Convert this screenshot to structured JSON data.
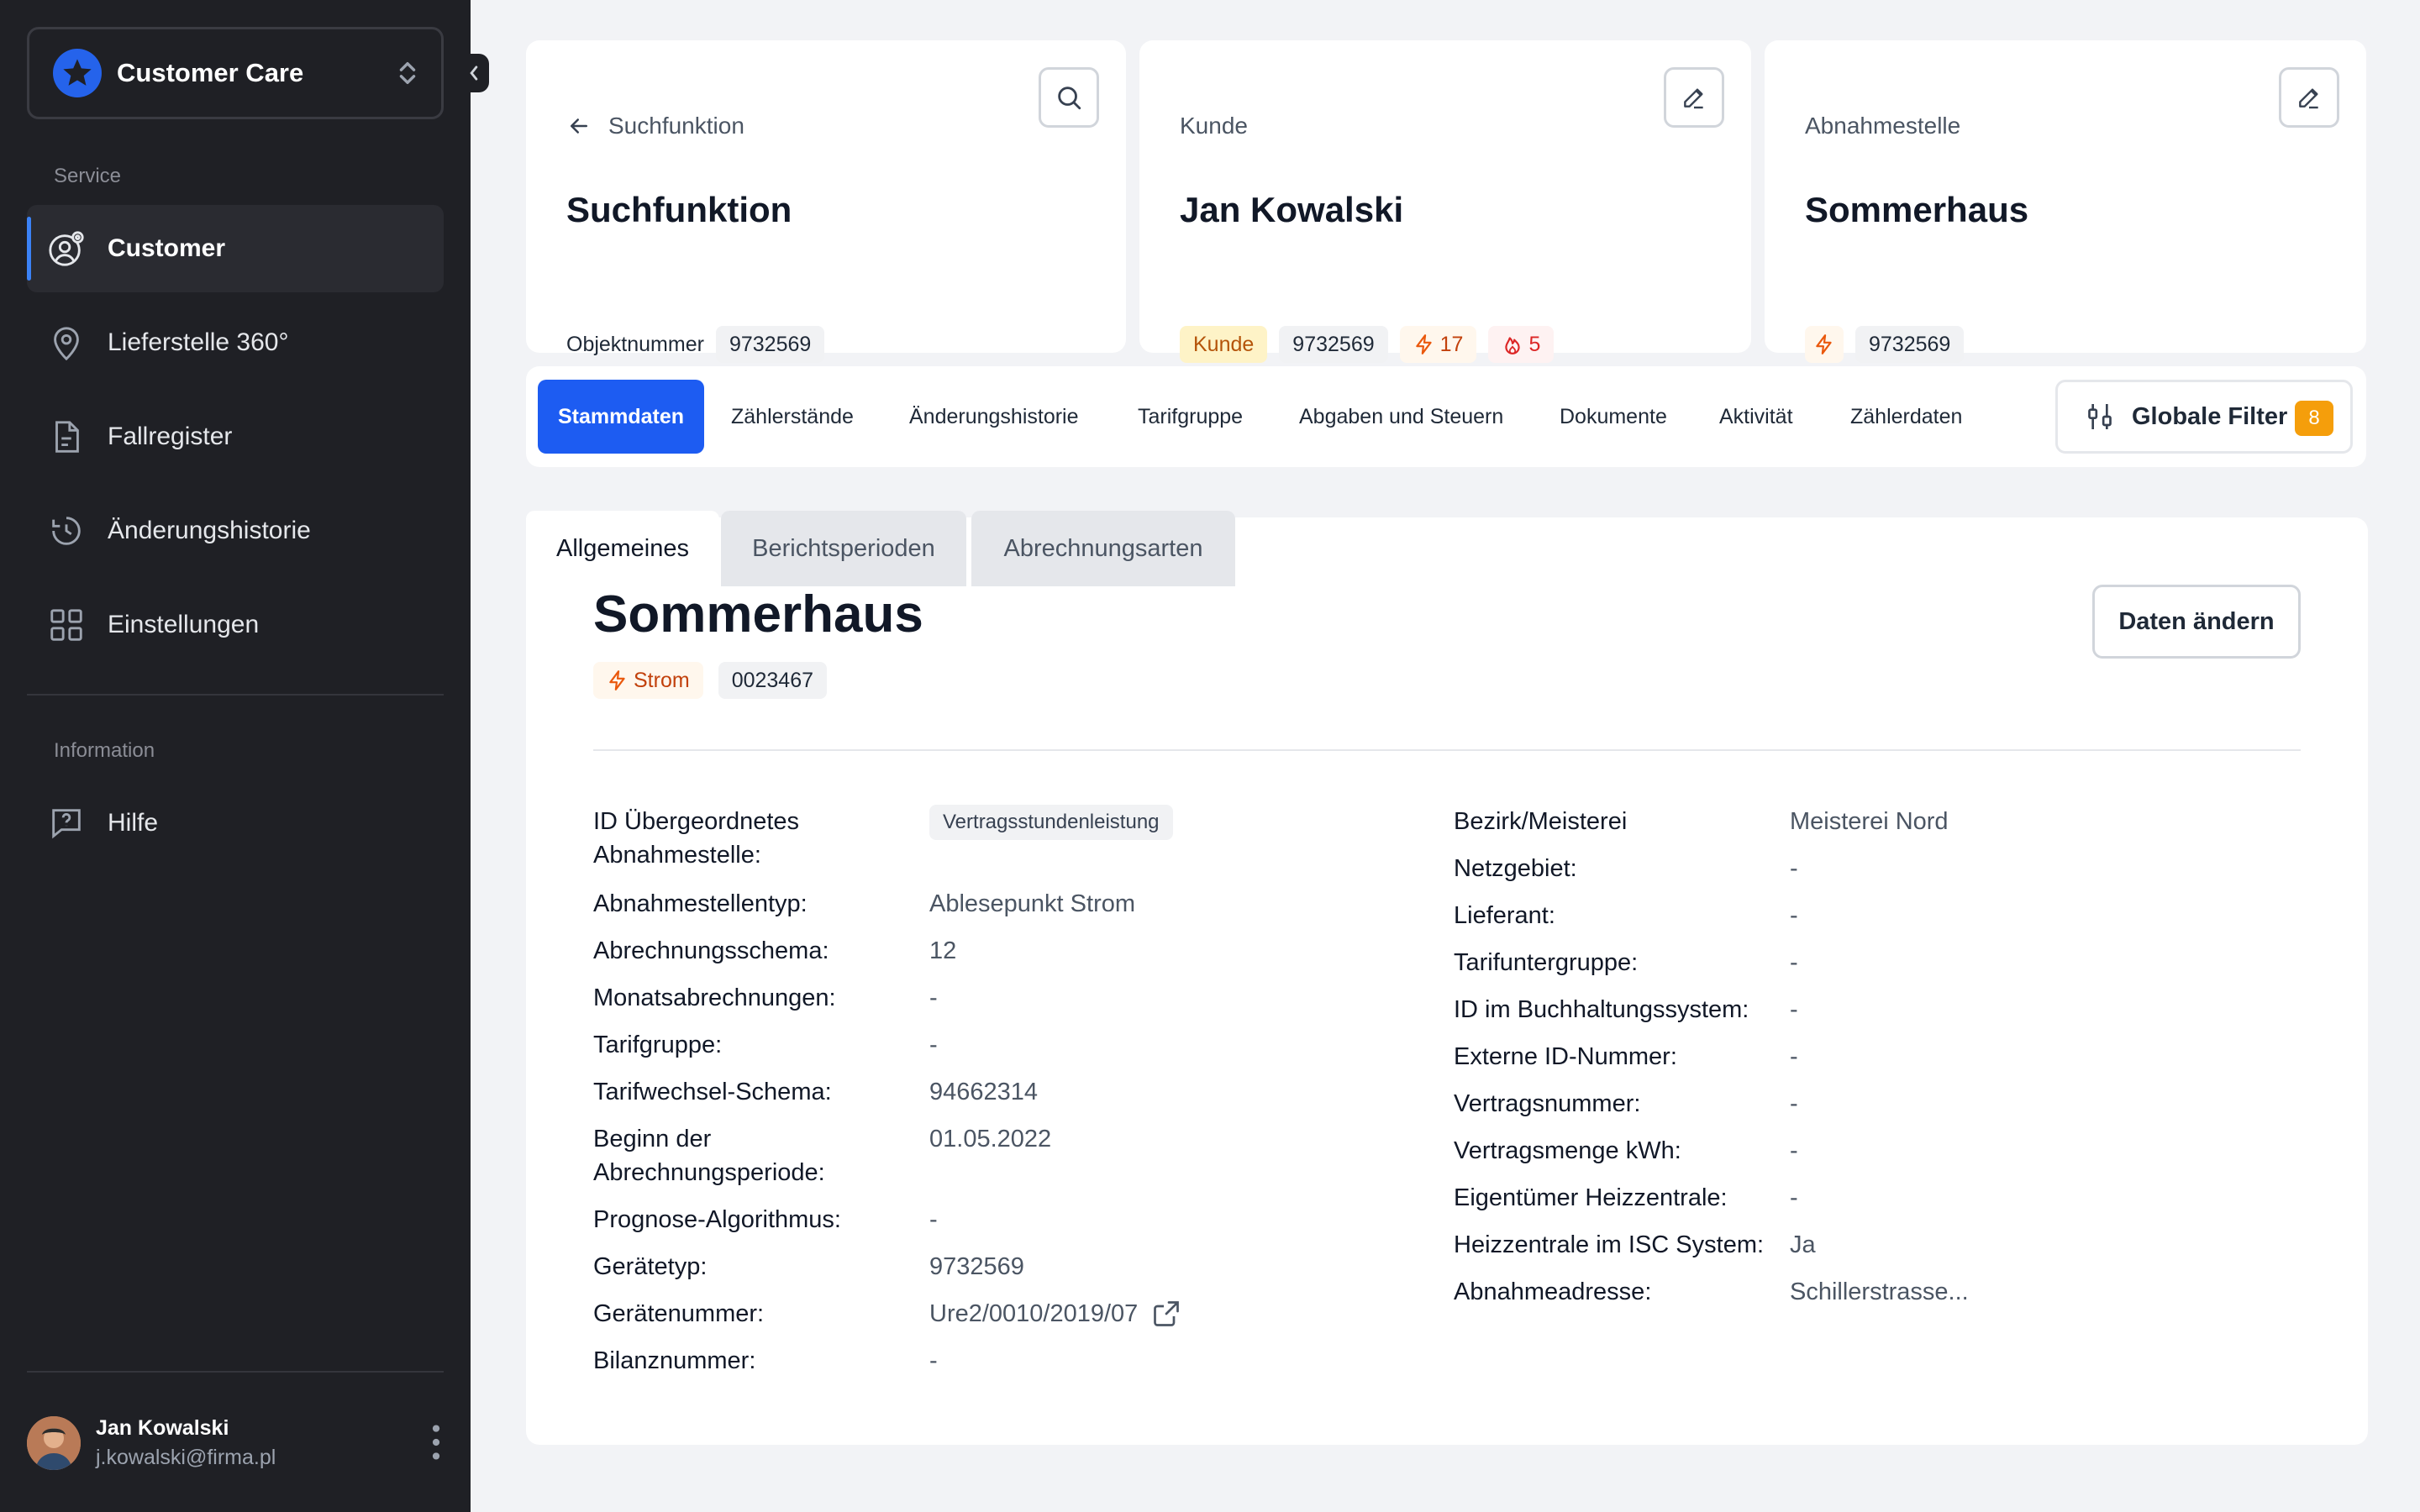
{
  "sidebar": {
    "workspace": "Customer Care",
    "section_service": "Service",
    "items": [
      {
        "label": "Customer",
        "icon": "user-settings-icon"
      },
      {
        "label": "Lieferstelle 360°",
        "icon": "map-pin-icon"
      },
      {
        "label": "Fallregister",
        "icon": "document-icon"
      },
      {
        "label": "Änderungshistorie",
        "icon": "history-icon"
      },
      {
        "label": "Einstellungen",
        "icon": "grid-icon"
      }
    ],
    "section_information": "Information",
    "help_label": "Hilfe",
    "user": {
      "name": "Jan Kowalski",
      "email": "j.kowalski@firma.pl"
    }
  },
  "cards": {
    "search": {
      "header": "Suchfunktion",
      "title": "Suchfunktion",
      "object_label": "Objektnummer",
      "object_number": "9732569"
    },
    "customer": {
      "header": "Kunde",
      "title": "Jan Kowalski",
      "tag_kunde": "Kunde",
      "number": "9732569",
      "power_count": "17",
      "heat_count": "5"
    },
    "point": {
      "header": "Abnahmestelle",
      "title": "Sommerhaus",
      "number": "9732569"
    }
  },
  "tabs": {
    "items": [
      "Stammdaten",
      "Zählerstände",
      "Änderungshistorie",
      "Tarifgruppe",
      "Abgaben und Steuern",
      "Dokumente",
      "Aktivität",
      "Zählerdaten"
    ],
    "active": "Stammdaten",
    "filter_label": "Globale Filter",
    "filter_count": "8"
  },
  "panel": {
    "subtabs": [
      "Allgemeines",
      "Berichtsperioden",
      "Abrechnungsarten"
    ],
    "title": "Sommerhaus",
    "tag_type": "Strom",
    "tag_id": "0023467",
    "edit_label": "Daten ändern",
    "left_fields": [
      {
        "label": "ID Übergeordnetes Abnahmestelle:",
        "value": "Vertragsstundenleistung"
      },
      {
        "label": "Abnahmestellentyp:",
        "value": "Ablesepunkt Strom"
      },
      {
        "label": "Abrechnungsschema:",
        "value": "12"
      },
      {
        "label": "Monatsabrechnungen:",
        "value": "-"
      },
      {
        "label": "Tarifgruppe:",
        "value": "-"
      },
      {
        "label": "Tarifwechsel-Schema:",
        "value": "94662314"
      },
      {
        "label": "Beginn der Abrechnungsperiode:",
        "value": "01.05.2022"
      },
      {
        "label": "Prognose-Algorithmus:",
        "value": "-"
      },
      {
        "label": "Gerätetyp:",
        "value": "9732569"
      },
      {
        "label": "Gerätenummer:",
        "value": "Ure2/0010/2019/07"
      },
      {
        "label": "Bilanznummer:",
        "value": "-"
      }
    ],
    "right_fields": [
      {
        "label": "Bezirk/Meisterei",
        "value": "Meisterei Nord"
      },
      {
        "label": "Netzgebiet:",
        "value": "-"
      },
      {
        "label": "Lieferant:",
        "value": "-"
      },
      {
        "label": "Tarifuntergruppe:",
        "value": "-"
      },
      {
        "label": "ID im Buchhaltungssystem:",
        "value": "-"
      },
      {
        "label": "Externe ID-Nummer:",
        "value": "-"
      },
      {
        "label": "Vertragsnummer:",
        "value": "-"
      },
      {
        "label": "Vertragsmenge kWh:",
        "value": "-"
      },
      {
        "label": "Eigentümer Heizzentrale:",
        "value": "-"
      },
      {
        "label": "Heizzentrale im ISC System:",
        "value": "Ja"
      },
      {
        "label": "Abnahmeadresse:",
        "value": "Schillerstrasse..."
      }
    ]
  },
  "colors": {
    "sidebar_bg": "#1f2025",
    "accent": "#1d5cf2",
    "warning": "#f59e0b"
  }
}
